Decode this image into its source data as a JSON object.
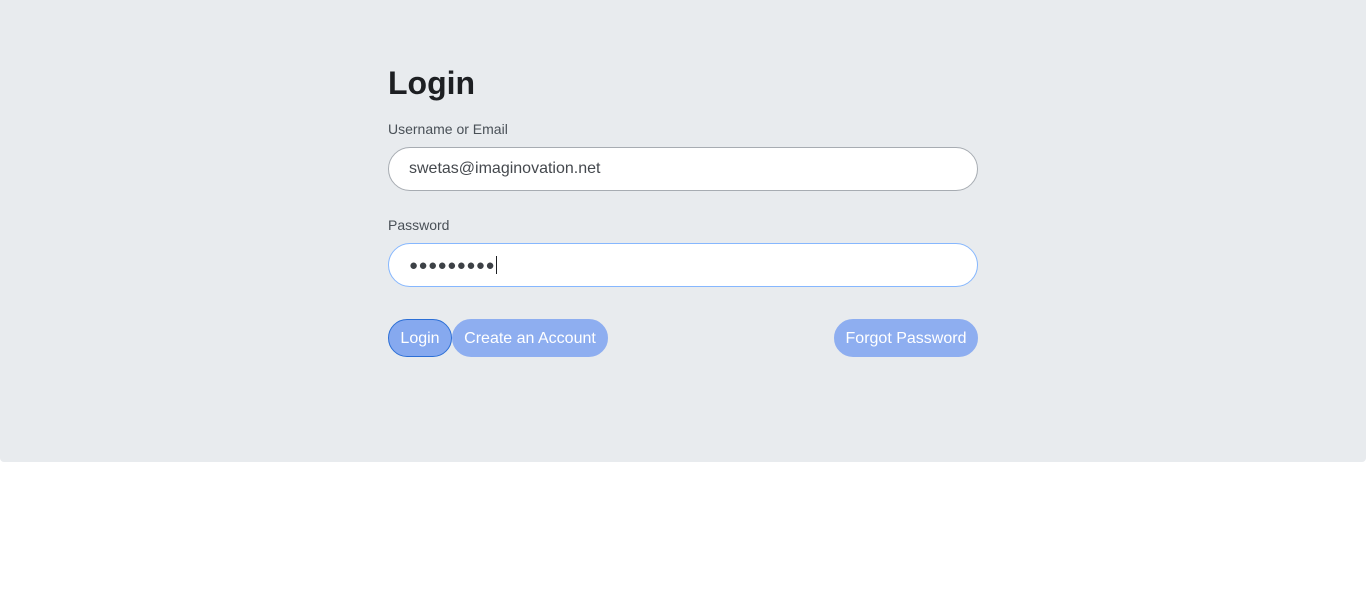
{
  "form": {
    "title": "Login",
    "username_label": "Username or Email",
    "username_value": "swetas@imaginovation.net",
    "password_label": "Password",
    "password_masked": "●●●●●●●●●"
  },
  "buttons": {
    "login": "Login",
    "create_account": "Create an Account",
    "forgot_password": "Forgot Password"
  },
  "colors": {
    "panel_background": "#e8ebee",
    "button_background": "#8eaef0",
    "focus_border": "#86b7fe"
  }
}
